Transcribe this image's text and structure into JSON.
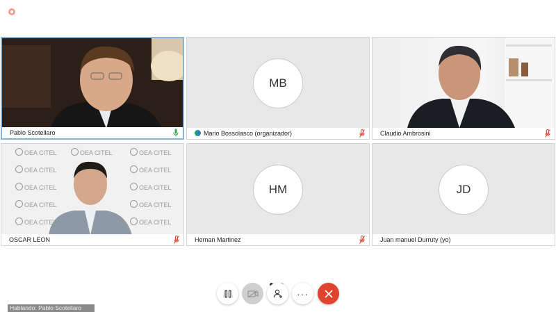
{
  "window": {
    "recording_indicator": "record-dot-icon"
  },
  "participants": [
    {
      "name": "Pablo Scotellaro",
      "type": "video",
      "mic": "active",
      "speaking": true
    },
    {
      "name": "Mario Bossolasco (organizador)",
      "type": "avatar",
      "initials": "MB",
      "mic": "muted"
    },
    {
      "name": "Claudio Ambrosini",
      "type": "video",
      "mic": "muted"
    },
    {
      "name": "OSCAR LEON",
      "type": "video",
      "mic": "muted",
      "background_text": "OEA CITEL"
    },
    {
      "name": "Hernan Martinez",
      "type": "avatar",
      "initials": "HM",
      "mic": "muted"
    },
    {
      "name": "Juan manuel Durruty (yo)",
      "type": "avatar",
      "initials": "JD"
    }
  ],
  "pagination": {
    "current": 1,
    "total": 2
  },
  "controls": {
    "pause_icon": "pause-icon",
    "camera_icon": "camera-off-icon",
    "people_icon": "add-person-icon",
    "more_label": "···",
    "hangup_icon": "close-icon"
  },
  "status": {
    "speaking_text": "Hablando: Pablo Scotellaro"
  },
  "colors": {
    "accent_border": "#8ab4d8",
    "hangup": "#e0442e",
    "mic_muted": "#e0442e",
    "mic_active": "#2fa84f"
  }
}
